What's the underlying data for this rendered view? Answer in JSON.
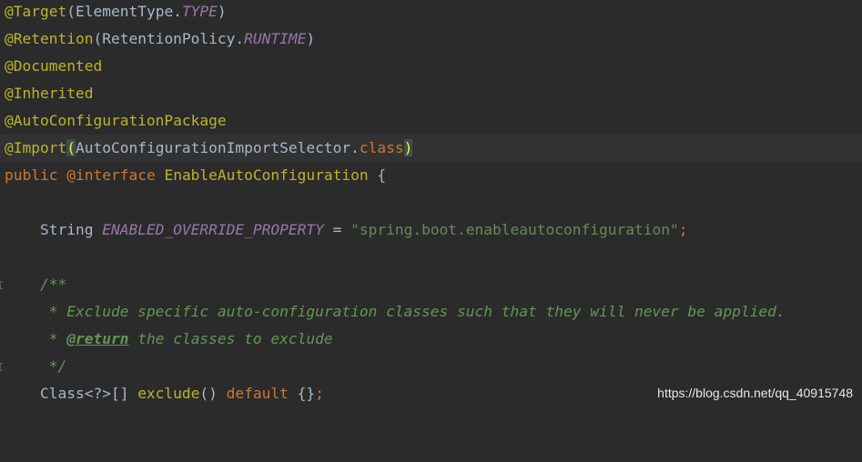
{
  "lines": [
    {
      "seg": [
        "@Target",
        "(",
        "ElementType.",
        "TYPE",
        ")"
      ]
    },
    {
      "seg": [
        "@Retention",
        "(",
        "RetentionPolicy.",
        "RUNTIME",
        ")"
      ]
    },
    {
      "seg": [
        "@Documented"
      ]
    },
    {
      "seg": [
        "@Inherited"
      ]
    },
    {
      "seg": [
        "@AutoConfigurationPackage"
      ]
    },
    {
      "seg": [
        "@Import",
        "(",
        "AutoConfigurationImportSelector.",
        "class",
        ")"
      ]
    },
    {
      "seg": [
        "public",
        " ",
        "@interface",
        " EnableAutoConfiguration ",
        "{"
      ]
    },
    {
      "seg": []
    },
    {
      "seg": [
        "    String ",
        "ENABLED_OVERRIDE_PROPERTY",
        " = ",
        "\"spring.boot.enableautoconfiguration\"",
        ";"
      ]
    },
    {
      "seg": []
    },
    {
      "seg": [
        "    /**"
      ]
    },
    {
      "seg": [
        "     * Exclude specific auto-configuration classes such that they will never be applied."
      ]
    },
    {
      "seg": [
        "     * ",
        "@return",
        " the classes to exclude"
      ]
    },
    {
      "seg": [
        "     */"
      ]
    },
    {
      "seg": [
        "    Class<?>[] ",
        "exclude",
        "() ",
        "default",
        " {}",
        ";"
      ]
    }
  ],
  "watermark": "https://blog.csdn.net/qq_40915748"
}
